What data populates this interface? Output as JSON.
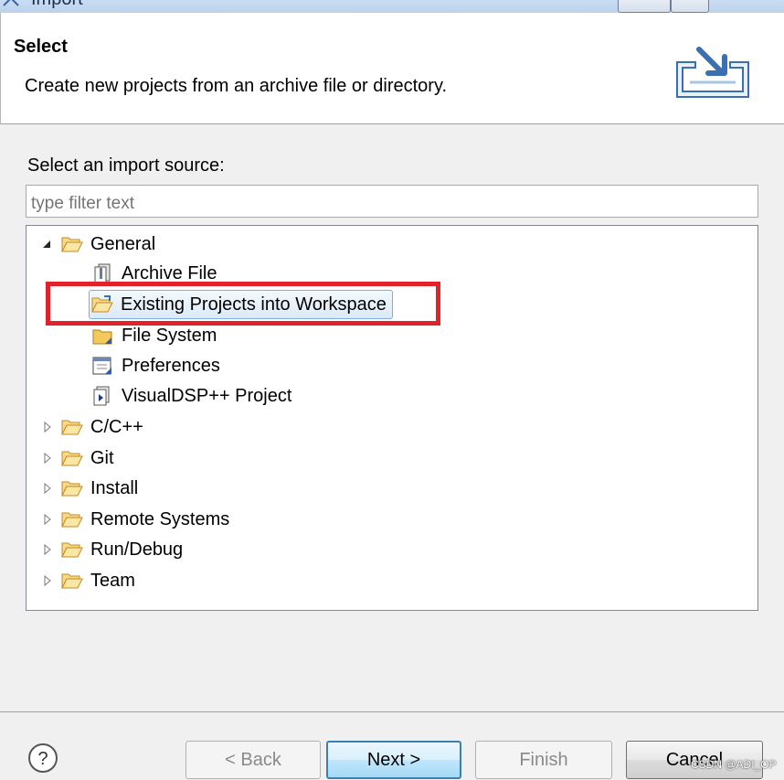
{
  "window": {
    "title": "Import"
  },
  "header": {
    "title": "Select",
    "description": "Create new projects from an archive file or directory."
  },
  "source": {
    "label": "Select an import source:",
    "filter_placeholder": "type filter text"
  },
  "tree": {
    "general": "General",
    "archive_file": "Archive File",
    "existing_projects": "Existing Projects into Workspace",
    "file_system": "File System",
    "preferences": "Preferences",
    "visualdsp": "VisualDSP++ Project",
    "cpp": "C/C++",
    "git": "Git",
    "install": "Install",
    "remote_systems": "Remote Systems",
    "run_debug": "Run/Debug",
    "team": "Team"
  },
  "buttons": {
    "help": "?",
    "back": "< Back",
    "next": "Next >",
    "finish": "Finish",
    "cancel": "Cancel"
  },
  "watermark": "CSDN @ADI_OP",
  "colors": {
    "highlight": "#e3212b",
    "selection": "#84acdd",
    "folder": "#e8b84a"
  }
}
